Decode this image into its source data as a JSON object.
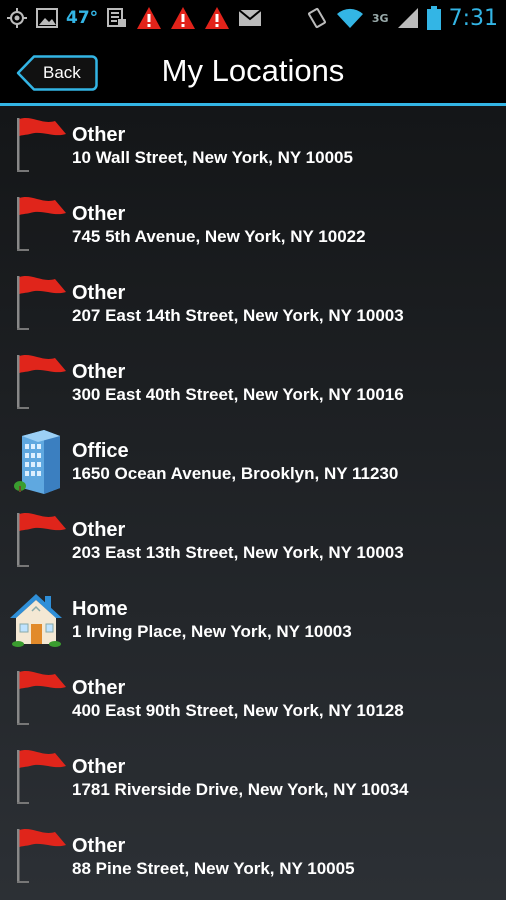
{
  "status_bar": {
    "temperature": "47°",
    "network": "3G",
    "time": "7:31"
  },
  "header": {
    "back_label": "Back",
    "title": "My Locations"
  },
  "locations": [
    {
      "type": "Other",
      "address": "10 Wall Street, New York, NY 10005",
      "icon": "flag-icon"
    },
    {
      "type": "Other",
      "address": "745 5th Avenue, New York, NY 10022",
      "icon": "flag-icon"
    },
    {
      "type": "Other",
      "address": "207 East 14th Street, New York, NY 10003",
      "icon": "flag-icon"
    },
    {
      "type": "Other",
      "address": "300 East 40th Street, New York, NY 10016",
      "icon": "flag-icon"
    },
    {
      "type": "Office",
      "address": "1650 Ocean Avenue, Brooklyn, NY 11230",
      "icon": "office-building-icon"
    },
    {
      "type": "Other",
      "address": "203 East 13th Street, New York, NY 10003",
      "icon": "flag-icon"
    },
    {
      "type": "Home",
      "address": "1 Irving Place, New York, NY 10003",
      "icon": "house-icon"
    },
    {
      "type": "Other",
      "address": "400 East 90th Street, New York, NY 10128",
      "icon": "flag-icon"
    },
    {
      "type": "Other",
      "address": "1781 Riverside Drive, New York, NY 10034",
      "icon": "flag-icon"
    },
    {
      "type": "Other",
      "address": "88 Pine Street, New York, NY 10005",
      "icon": "flag-icon"
    }
  ],
  "colors": {
    "accent": "#33b5e5",
    "flag_red": "#e0251b"
  }
}
